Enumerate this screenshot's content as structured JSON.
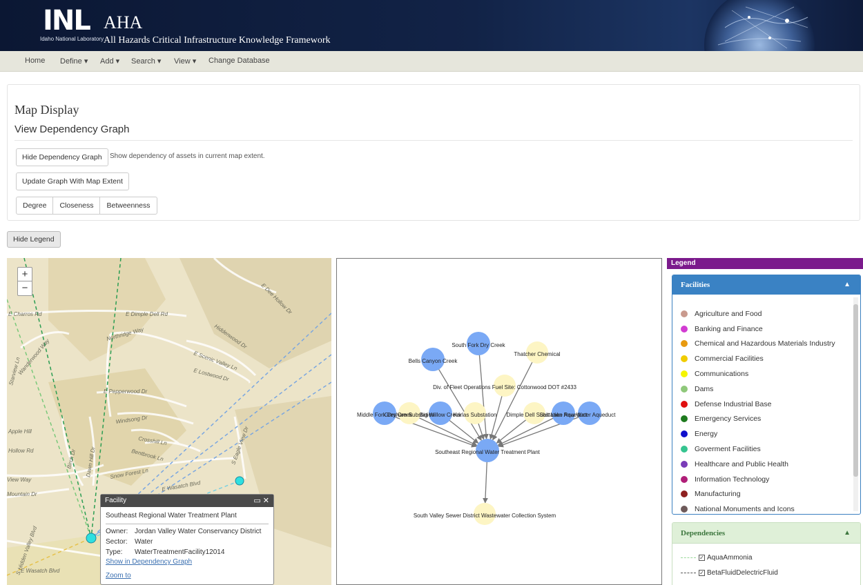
{
  "header": {
    "logo_text": "INL",
    "logo_subtitle": "Idaho National Laboratory",
    "app_title": "AHA",
    "app_subtitle": "All Hazards Critical Infrastructure Knowledge Framework"
  },
  "nav": {
    "home": "Home",
    "define": "Define ▾",
    "add": "Add ▾",
    "search": "Search ▾",
    "view": "View ▾",
    "change_db": "Change Database"
  },
  "panel": {
    "title": "Map Display",
    "subtitle": "View Dependency Graph",
    "hide_graph_button": "Hide Dependency Graph",
    "hide_graph_note": "Show dependency of assets in current map extent.",
    "update_button": "Update Graph With Map Extent",
    "metrics": [
      "Degree",
      "Closeness",
      "Betweenness"
    ]
  },
  "hide_legend_button": "Hide Legend",
  "map": {
    "zoom_in": "+",
    "zoom_out": "−",
    "street_labels": [
      "E Charros Rd",
      "E Dimple Dell Rd",
      "Northridge Way",
      "E Scenic Valley Ln",
      "E Lostwood Dr",
      "Hiddenwood Dr",
      "E Pepperwood Dr",
      "Windsong Dr",
      "Crosshill Ln",
      "Bentbrook Ln",
      "Snow Forest Ln",
      "E Wasatch Blvd",
      "S Eagle View Dr",
      "Dawn Hill Dr",
      "Birch Dr",
      "Apple Hill",
      "Hollow Rd",
      "View Way",
      "Mountain Dr",
      "Wanderwood Way",
      "Starview Ln",
      "S Hidden Valley Blvd",
      "E Wasatch Blvd",
      "E Dee Hollow Dr"
    ],
    "popup": {
      "header": "Facility",
      "controls": "▭ ✕",
      "name": "Southeast Regional Water Treatment Plant",
      "owner_label": "Owner:",
      "owner": "Jordan Valley Water Conservancy District",
      "sector_label": "Sector:",
      "sector": "Water",
      "type_label": "Type:",
      "type": "WaterTreatmentFacility12014",
      "show_link": "Show in Dependency Graph",
      "zoom_link": "Zoom to"
    }
  },
  "graph": {
    "nodes": [
      {
        "id": "south_fork",
        "label": "South Fork Dry Creek",
        "color": "#7aa9f5"
      },
      {
        "id": "bells",
        "label": "Bells Canyon Creek",
        "color": "#7aa9f5"
      },
      {
        "id": "thatcher",
        "label": "Thatcher Chemical",
        "color": "#fdf5c4"
      },
      {
        "id": "fleet",
        "label": "Div. of Fleet Operations Fuel Site: Cottonwood DOT #2433",
        "color": "#fdf5c4"
      },
      {
        "id": "middle_fork",
        "label": "Middle Fork Dry Creek",
        "color": "#7aa9f5"
      },
      {
        "id": "gresham",
        "label": "Gresham Substation",
        "color": "#fdf5c4"
      },
      {
        "id": "big_willow",
        "label": "Big Willow Creek",
        "color": "#7aa9f5"
      },
      {
        "id": "karlas",
        "label": "Karlas Substation",
        "color": "#fdf5c4"
      },
      {
        "id": "dimple",
        "label": "Dimple Dell Substation",
        "color": "#fdf5c4"
      },
      {
        "id": "salt_lake_aq",
        "label": "Salt Lake Aqueduct",
        "color": "#7aa9f5"
      },
      {
        "id": "raw_water",
        "label": "Raw Water Aqueduct",
        "color": "#7aa9f5"
      },
      {
        "id": "plant",
        "label": "Southeast Regional Water Treatment Plant",
        "color": "#7aa9f5"
      },
      {
        "id": "sewer",
        "label": "South Valley Sewer District Wastewater Collection System",
        "color": "#fdf5c4"
      }
    ]
  },
  "legend": {
    "header": "Legend",
    "facilities_title": "Facilities",
    "facilities": [
      {
        "label": "Agriculture and Food",
        "color": "#c99a8e"
      },
      {
        "label": "Banking and Finance",
        "color": "#d23cd2"
      },
      {
        "label": "Chemical and Hazardous Materials Industry",
        "color": "#e89a10"
      },
      {
        "label": "Commercial Facilities",
        "color": "#f0cc00"
      },
      {
        "label": "Communications",
        "color": "#f5f500"
      },
      {
        "label": "Dams",
        "color": "#8fc87a"
      },
      {
        "label": "Defense Industrial Base",
        "color": "#e01010"
      },
      {
        "label": "Emergency Services",
        "color": "#1e7a1e"
      },
      {
        "label": "Energy",
        "color": "#1010cc"
      },
      {
        "label": "Goverment Facilities",
        "color": "#36c490"
      },
      {
        "label": "Healthcare and Public Health",
        "color": "#7a3cb8"
      },
      {
        "label": "Information Technology",
        "color": "#b01e78"
      },
      {
        "label": "Manufacturing",
        "color": "#8e2020"
      },
      {
        "label": "National Monuments and Icons",
        "color": "#6e5a5a"
      }
    ],
    "dependencies_title": "Dependencies",
    "dependencies": [
      {
        "label": "AquaAmmonia",
        "color": "#9ad89a"
      },
      {
        "label": "BetaFluidDelectricFluid",
        "color": "#555555"
      }
    ]
  }
}
